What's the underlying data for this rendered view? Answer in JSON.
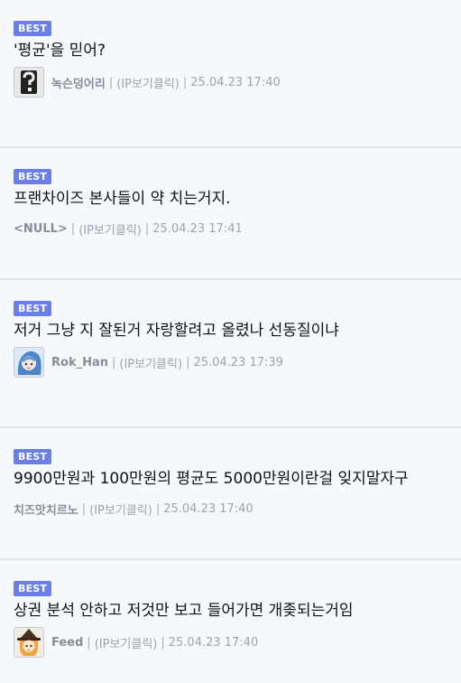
{
  "comments": [
    {
      "badge": "BEST",
      "text": "'평균'을 믿어?",
      "has_avatar": true,
      "avatar_icon": "question-mark-avatar-icon",
      "nickname": "녹슨덩어리",
      "separator": "|",
      "ip": "(IP보기클릭)",
      "date": "25.04.23 17:40"
    },
    {
      "badge": "BEST",
      "text": "프랜차이즈 본사들이 약 치는거지.",
      "has_avatar": false,
      "nickname": "<NULL>",
      "separator": "|",
      "ip": "(IP보기클릭)",
      "date": "25.04.23 17:41"
    },
    {
      "badge": "BEST",
      "text": "저거 그냥 지 잘된거 자랑할려고 올렸나 선동질이냐",
      "has_avatar": true,
      "avatar_icon": "anime-character-avatar-icon",
      "nickname": "Rok_Han",
      "separator": "|",
      "ip": "(IP보기클릭)",
      "date": "25.04.23 17:39"
    },
    {
      "badge": "BEST",
      "text": "9900만원과 100만원의 평균도 5000만원이란걸 잊지말자구",
      "has_avatar": false,
      "nickname": "치즈맛치르노",
      "separator": "|",
      "ip": "(IP보기클릭)",
      "date": "25.04.23 17:40"
    },
    {
      "badge": "BEST",
      "text": "상권 분석 안하고 저것만 보고 들어가면 개좆되는거임",
      "has_avatar": true,
      "avatar_icon": "witch-character-avatar-icon",
      "nickname": "Feed",
      "separator": "|",
      "ip": "(IP보기클릭)",
      "date": "25.04.23 17:40"
    }
  ],
  "colors": {
    "badge": "#6b7fe6",
    "background": "#f5f8fd",
    "divider": "#dfe3ea",
    "meta_text": "#a0a4aa"
  }
}
